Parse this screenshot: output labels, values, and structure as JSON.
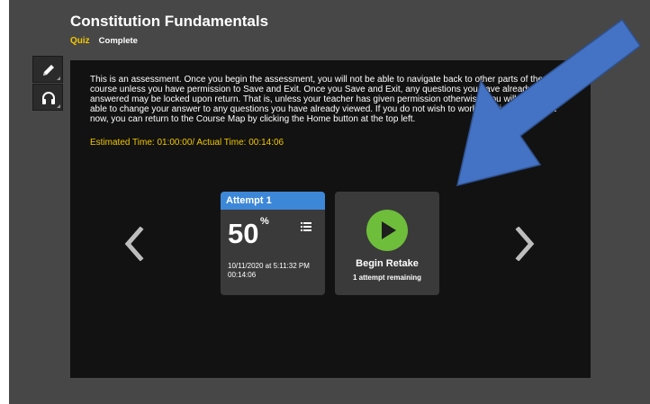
{
  "course": {
    "title": "Constitution Fundamentals",
    "type": "Quiz",
    "status": "Complete"
  },
  "tools": [
    {
      "name": "pencil-icon"
    },
    {
      "name": "headphones-icon"
    }
  ],
  "assessment": {
    "description": "This is an assessment. Once you begin the assessment, you will not be able to navigate back to other parts of the course unless you have permission to Save and Exit. Once you Save and Exit, any questions you have already answered may be locked upon return. That is, unless your teacher has given permission otherwise, you will not be able to change your answer to any questions you have already viewed. If you do not wish to work on this assessment now, you can return to the Course Map by clicking the Home button at the top left.",
    "time_line": "Estimated Time: 01:00:00/ Actual Time: 00:14:06"
  },
  "attempt": {
    "header": "Attempt 1",
    "score": "50",
    "score_unit": "%",
    "date": "10/11/2020 at 5:11:32 PM",
    "duration": "00:14:06"
  },
  "retake": {
    "label": "Begin Retake",
    "remaining": "1 attempt remaining"
  },
  "colors": {
    "accent_blue": "#3d87d8",
    "accent_yellow": "#f2c700",
    "play_green": "#6ebd3b",
    "annotation_arrow": "#4472c4"
  }
}
